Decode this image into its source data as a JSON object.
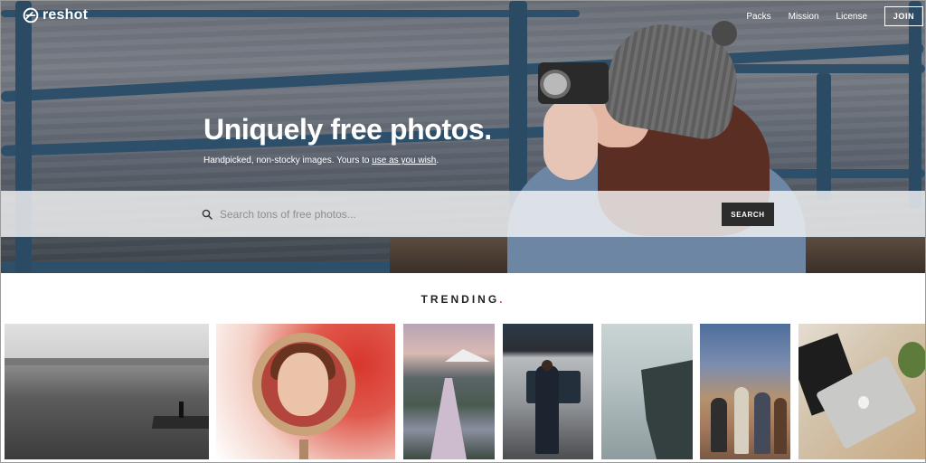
{
  "brand": {
    "name": "reshot"
  },
  "nav": {
    "links": [
      "Packs",
      "Mission",
      "License"
    ],
    "join_label": "JOIN"
  },
  "hero": {
    "headline": "Uniquely free photos.",
    "subline_prefix": "Handpicked, non-stocky images. Yours to ",
    "subline_link": "use as you wish",
    "subline_suffix": "."
  },
  "search": {
    "placeholder": "Search tons of free photos...",
    "button_label": "SEARCH"
  },
  "trending": {
    "title": "TRENDING",
    "dot": ".",
    "accent_color": "#e8392a"
  },
  "thumbnails": [
    {
      "subject": "pier-lake-photo"
    },
    {
      "subject": "mirror-portrait-photo"
    },
    {
      "subject": "river-valley-photo"
    },
    {
      "subject": "subway-train-photo"
    },
    {
      "subject": "foggy-cliff-photo"
    },
    {
      "subject": "canyon-group-photo"
    },
    {
      "subject": "laptop-desk-photo"
    }
  ]
}
